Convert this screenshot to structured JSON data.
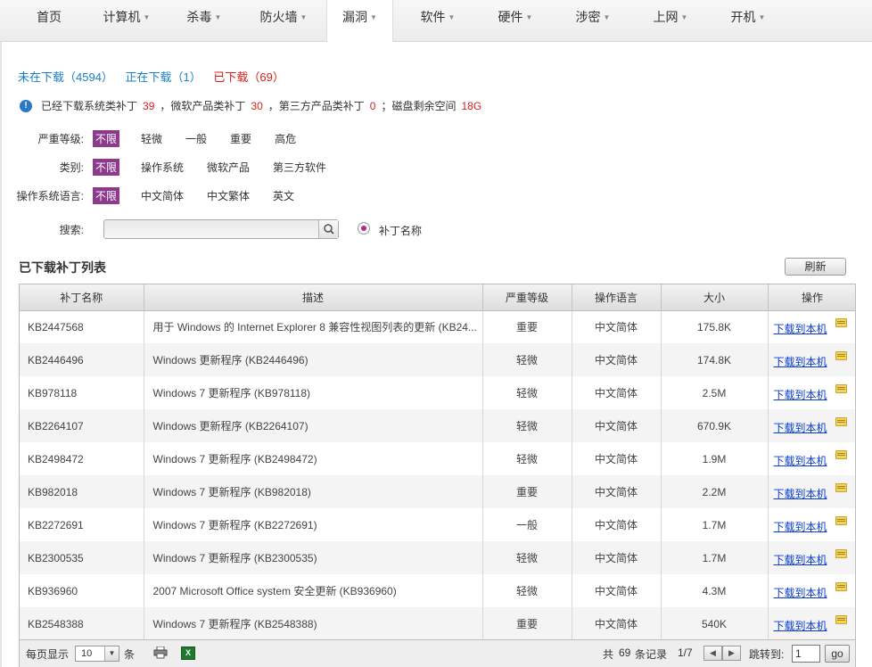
{
  "nav": {
    "items": [
      {
        "label": "首页",
        "dropdown": false
      },
      {
        "label": "计算机",
        "dropdown": true
      },
      {
        "label": "杀毒",
        "dropdown": true
      },
      {
        "label": "防火墙",
        "dropdown": true
      },
      {
        "label": "漏洞",
        "dropdown": true,
        "active": true
      },
      {
        "label": "软件",
        "dropdown": true
      },
      {
        "label": "硬件",
        "dropdown": true
      },
      {
        "label": "涉密",
        "dropdown": true
      },
      {
        "label": "上网",
        "dropdown": true
      },
      {
        "label": "开机",
        "dropdown": true
      }
    ]
  },
  "status_tabs": {
    "not_downloaded": "未在下载（4594）",
    "downloading": "正在下载（1）",
    "downloaded": "已下载（69）"
  },
  "info": {
    "text1": "已经下载系统类补丁",
    "system_count": "39",
    "text2": "，微软产品类补丁",
    "ms_count": "30",
    "text3": "，第三方产品类补丁",
    "third_count": "0",
    "text4": "；磁盘剩余空间",
    "disk_free": "18G"
  },
  "filters": {
    "severity": {
      "label": "严重等级:",
      "options": [
        "不限",
        "轻微",
        "一般",
        "重要",
        "高危"
      ]
    },
    "category": {
      "label": "类别:",
      "options": [
        "不限",
        "操作系统",
        "微软产品",
        "第三方软件"
      ]
    },
    "language": {
      "label": "操作系统语言:",
      "options": [
        "不限",
        "中文简体",
        "中文繁体",
        "英文"
      ]
    }
  },
  "search": {
    "label": "搜索:",
    "value": "",
    "radio_label": "补丁名称"
  },
  "list": {
    "title": "已下载补丁列表",
    "refresh": "刷新",
    "columns": [
      "补丁名称",
      "描述",
      "严重等级",
      "操作语言",
      "大小",
      "操作"
    ],
    "rows": [
      {
        "name": "KB2447568",
        "desc": "用于 Windows 的 Internet Explorer 8 兼容性视图列表的更新 (KB24...",
        "severity": "重要",
        "lang": "中文简体",
        "size": "175.8K",
        "action": "下载到本机"
      },
      {
        "name": "KB2446496",
        "desc": "Windows 更新程序 (KB2446496)",
        "severity": "轻微",
        "lang": "中文简体",
        "size": "174.8K",
        "action": "下载到本机"
      },
      {
        "name": "KB978118",
        "desc": "Windows 7 更新程序 (KB978118)",
        "severity": "轻微",
        "lang": "中文简体",
        "size": "2.5M",
        "action": "下载到本机"
      },
      {
        "name": "KB2264107",
        "desc": "Windows 更新程序 (KB2264107)",
        "severity": "轻微",
        "lang": "中文简体",
        "size": "670.9K",
        "action": "下载到本机"
      },
      {
        "name": "KB2498472",
        "desc": "Windows 7 更新程序 (KB2498472)",
        "severity": "轻微",
        "lang": "中文简体",
        "size": "1.9M",
        "action": "下载到本机"
      },
      {
        "name": "KB982018",
        "desc": "Windows 7 更新程序 (KB982018)",
        "severity": "重要",
        "lang": "中文简体",
        "size": "2.2M",
        "action": "下载到本机"
      },
      {
        "name": "KB2272691",
        "desc": "Windows 7 更新程序 (KB2272691)",
        "severity": "一般",
        "lang": "中文简体",
        "size": "1.7M",
        "action": "下载到本机"
      },
      {
        "name": "KB2300535",
        "desc": "Windows 7 更新程序 (KB2300535)",
        "severity": "轻微",
        "lang": "中文简体",
        "size": "1.7M",
        "action": "下载到本机"
      },
      {
        "name": "KB936960",
        "desc": "2007 Microsoft Office system 安全更新 (KB936960)",
        "severity": "轻微",
        "lang": "中文简体",
        "size": "4.3M",
        "action": "下载到本机"
      },
      {
        "name": "KB2548388",
        "desc": "Windows 7 更新程序 (KB2548388)",
        "severity": "重要",
        "lang": "中文简体",
        "size": "540K",
        "action": "下载到本机"
      }
    ]
  },
  "pager": {
    "per_page_label": "每页显示",
    "per_page_value": "10",
    "per_page_unit": "条",
    "total_prefix": "共",
    "total": "69",
    "total_suffix": "条记录",
    "page_info": "1/7",
    "jump_label": "跳转到:",
    "jump_value": "1",
    "go_label": "go"
  }
}
